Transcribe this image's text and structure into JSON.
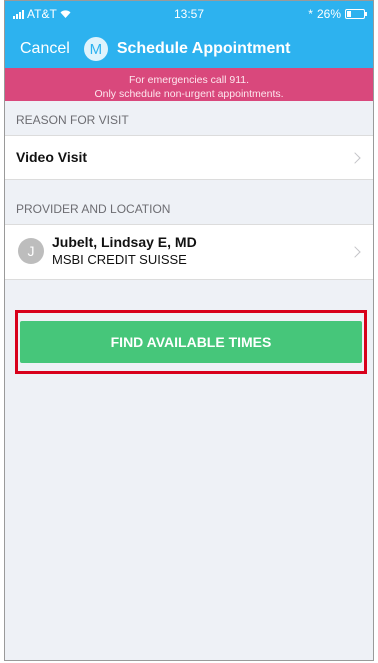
{
  "status_bar": {
    "carrier": "AT&T",
    "time": "13:57",
    "battery_text": "26%",
    "bluetooth_icon": "*"
  },
  "nav": {
    "cancel_label": "Cancel",
    "avatar_initial": "M",
    "title": "Schedule Appointment"
  },
  "alert": {
    "line1": "For emergencies call 911.",
    "line2": "Only schedule non-urgent appointments."
  },
  "reason_section": {
    "header": "REASON FOR VISIT",
    "value": "Video Visit"
  },
  "provider_section": {
    "header": "PROVIDER AND LOCATION",
    "avatar_initial": "J",
    "name": "Jubelt, Lindsay E, MD",
    "location": "MSBI CREDIT SUISSE"
  },
  "action": {
    "button_label": "FIND AVAILABLE TIMES"
  },
  "colors": {
    "header_bg": "#2db2ef",
    "alert_bg": "#d9487c",
    "button_bg": "#46c67a",
    "highlight_border": "#d8001b"
  }
}
